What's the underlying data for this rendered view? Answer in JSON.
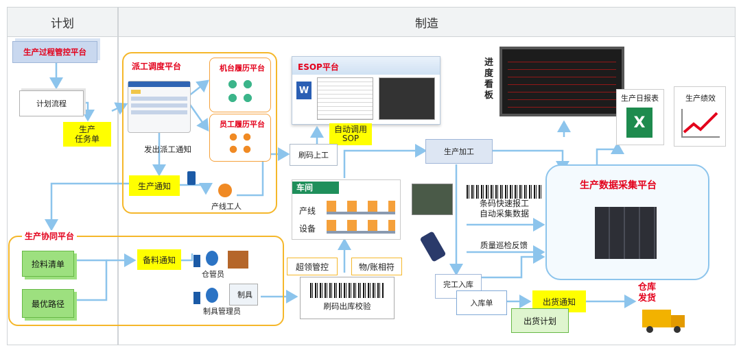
{
  "headers": {
    "plan": "计划",
    "manufacture": "制造"
  },
  "plan": {
    "platform": "生产过程管控平台",
    "flow": "计划流程",
    "task_sheet": "生产\n任务单"
  },
  "dispatch": {
    "title": "派工调度平台",
    "machine": "机台履历平台",
    "staff": "员工履历平台",
    "notify": "发出派工通知",
    "prod_notice": "生产通知",
    "worker": "产线工人"
  },
  "esop": {
    "title": "ESOP平台",
    "auto_sop": "自动调用\nSOP"
  },
  "scan_on": "刷码上工",
  "processing": "生产加工",
  "workshop": {
    "title": "车间",
    "line": "产线",
    "equip": "设备"
  },
  "board": "进\n度\n看\n板",
  "reports": {
    "daily": "生产日报表",
    "perf": "生产绩效"
  },
  "collect": {
    "title": "生产数据采集平台",
    "barcode": "条码快速报工\n自动采集数据",
    "quality": "质量巡检反馈"
  },
  "collab": {
    "title": "生产协同平台",
    "pick": "捡料清单",
    "route": "最优路径",
    "prep": "备料通知",
    "warehouse": "仓管员",
    "tooling": "制具",
    "tool_mgr": "制具管理员"
  },
  "over_ctrl": "超领管控",
  "match": "物/账相符",
  "scan_out": "刷码出库校验",
  "finish_in": "完工入库",
  "in_sheet": "入库单",
  "ship_notice": "出货通知",
  "ship_plan": "出货计划",
  "ship": "仓库\n发货",
  "colors": {
    "accent": "#f5b72a",
    "red": "#e3001b",
    "line": "#8cc4ec"
  }
}
